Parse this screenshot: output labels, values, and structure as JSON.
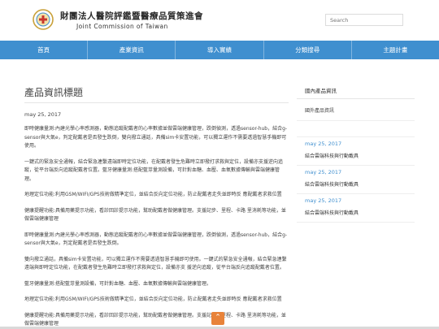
{
  "header": {
    "org_name_zh": "財團法人醫院評鑑暨醫療品質策進會",
    "org_name_en": "Joint Commission of Taiwan",
    "search_placeholder": "Search"
  },
  "nav": [
    "首頁",
    "產業資訊",
    "導入實績",
    "分類搜尋",
    "主題計畫"
  ],
  "article": {
    "title": "產品資訊標題",
    "date": "may 25, 2017",
    "paragraphs": [
      "即時健康量測:內建光學心率感測器，動態追蹤配戴者的心率數據並做雲端健康管理，跌倒偵測，透過sensor-hub，結合g-sensor與大氣e，判定配戴者是否發生跌倒，雙向撥立通話，具備sim卡安置功能，可以獨立運作不需要透過智慧手機即可使用。",
      "一鍵式的緊急安全通報，結合緊急連繫遠端即時定位功能，在配戴者發生危難時立即撥打求救與定位，設備亦支援逆向追蹤，從平台端反向追蹤配戴者位置。藍牙健康量測:搭配藍芽量測設備，可針對血糖、血壓、血氧數據傳輸與雲端健康管理。",
      "地理定位功能:利用GSM/WIFI/GPS技術做精準定位，並結合反向定位功能，防止配戴者走失並即時反 應配戴者求救位置",
      "健康提醒功能:具備用藥提示功能，看診回診提示功能，幫助配戴者做健康管理。支援記步、里程、卡路 里消耗等功能，並做雲端健康管理",
      "即時健康量測:內建光學心率感測器，動態追蹤配戴者的心率數據並做雲端健康管理，跌倒偵測，透過sensor-hub，結合g-sensor與大氣e，判定配戴者是否發生跌倒。",
      "雙向撥立通話，具備sim卡安置功能，可以獨立運作不需要透過智慧手機即可使用。一鍵式的緊急安全通報，結合緊急連繫遠端與即時定位功能，在配戴者發生危難時立即撥打求救與定位，設備亦支 援逆向追蹤，從平台端反向追蹤配戴者位置。",
      "藍牙健康量測:搭配藍芽量測設備，可針對血糖、血壓、血氧數據傳輸與雲端健康管理。",
      "地理定位功能:利用GSM/WIFI/GPS技術做精準定位，並結合反向定位功能，防止配戴者走失並即時反 應配戴者求救位置",
      "健康提醒功能:具備用藥提示功能，看診回診提示功能，幫助配戴者做健康管理。支援記步、里程、卡路 里消耗等功能，並做雲端健康管理"
    ]
  },
  "sidebar": {
    "heading": "國內產品資訊",
    "top_item": "國外產品資訊",
    "news": [
      {
        "date": "may 25, 2017",
        "title": "結合雲端科技與行動載具"
      },
      {
        "date": "may 25, 2017",
        "title": "結合雲端科技與行動載具"
      },
      {
        "date": "may 25, 2017",
        "title": "結合雲端科技與行動載具"
      }
    ]
  },
  "back_to_top_icon": "chevron-up-icon",
  "colors": {
    "nav": "#3f8fcf",
    "accent": "#e8833a"
  }
}
